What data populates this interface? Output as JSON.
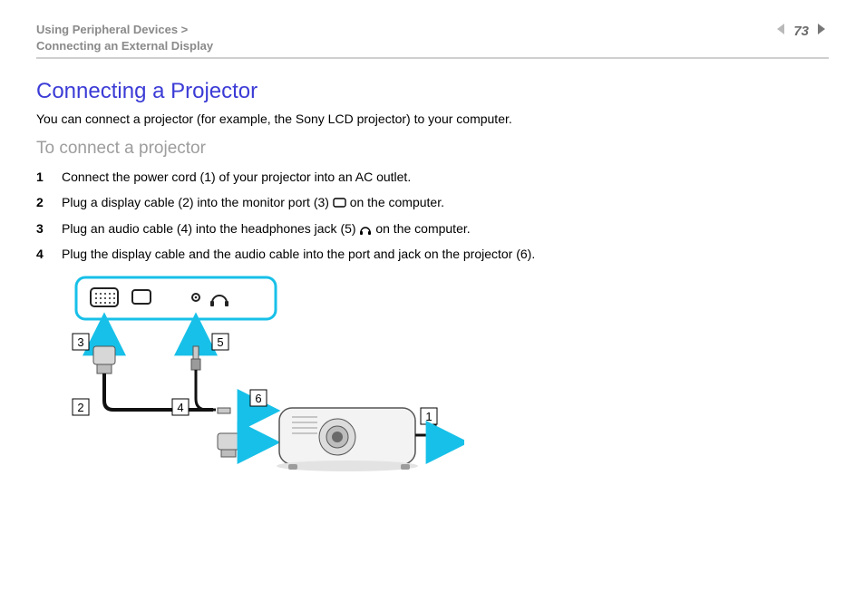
{
  "header": {
    "crumb_line1": "Using Peripheral Devices >",
    "crumb_line2": "Connecting an External Display",
    "page_number": "73"
  },
  "title": "Connecting a Projector",
  "intro": "You can connect a projector (for example, the Sony LCD projector) to your computer.",
  "subhead": "To connect a projector",
  "steps": [
    "Connect the power cord (1) of your projector into an AC outlet.",
    "Plug a display cable (2) into the monitor port (3) __MON__ on the computer.",
    "Plug an audio cable (4) into the headphones jack (5) __HP__ on the computer.",
    "Plug the display cable and the audio cable into the port and jack on the projector (6)."
  ],
  "labels": {
    "l1": "1",
    "l2": "2",
    "l3": "3",
    "l4": "4",
    "l5": "5",
    "l6": "6"
  }
}
